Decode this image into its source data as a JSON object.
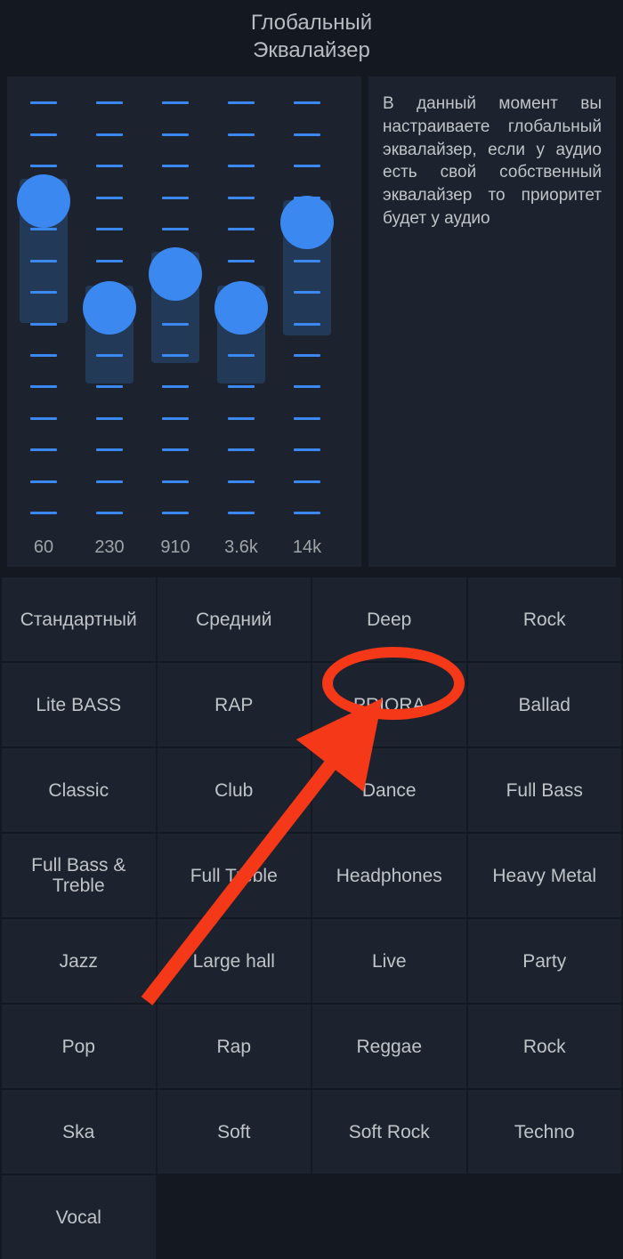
{
  "header": {
    "title_line1": "Глобальный",
    "title_line2": "Эквалайзер"
  },
  "info_text": "В данный момент вы настраиваете глобальный эквалайзер, если у аудио есть свой собственный эквалайзер то приоритет будет у аудио",
  "sliders": [
    {
      "label": "60",
      "value_pct": 75,
      "tick_count": 14
    },
    {
      "label": "230",
      "value_pct": 50,
      "tick_count": 14
    },
    {
      "label": "910",
      "value_pct": 58,
      "tick_count": 14
    },
    {
      "label": "3.6k",
      "value_pct": 50,
      "tick_count": 14
    },
    {
      "label": "14k",
      "value_pct": 70,
      "tick_count": 14
    }
  ],
  "presets": [
    "Стандартный",
    "Средний",
    "Deep",
    "Rock",
    "Lite BASS",
    "RAP",
    "PRIORA",
    "Ballad",
    "Classic",
    "Club",
    "Dance",
    "Full Bass",
    "Full Bass & Treble",
    "Full Treble",
    "Headphones",
    "Heavy Metal",
    "Jazz",
    "Large hall",
    "Live",
    "Party",
    "Pop",
    "Rap",
    "Reggae",
    "Rock",
    "Ska",
    "Soft",
    "Soft Rock",
    "Techno",
    "Vocal"
  ],
  "annotation": {
    "highlighted_preset": "PRIORA"
  }
}
